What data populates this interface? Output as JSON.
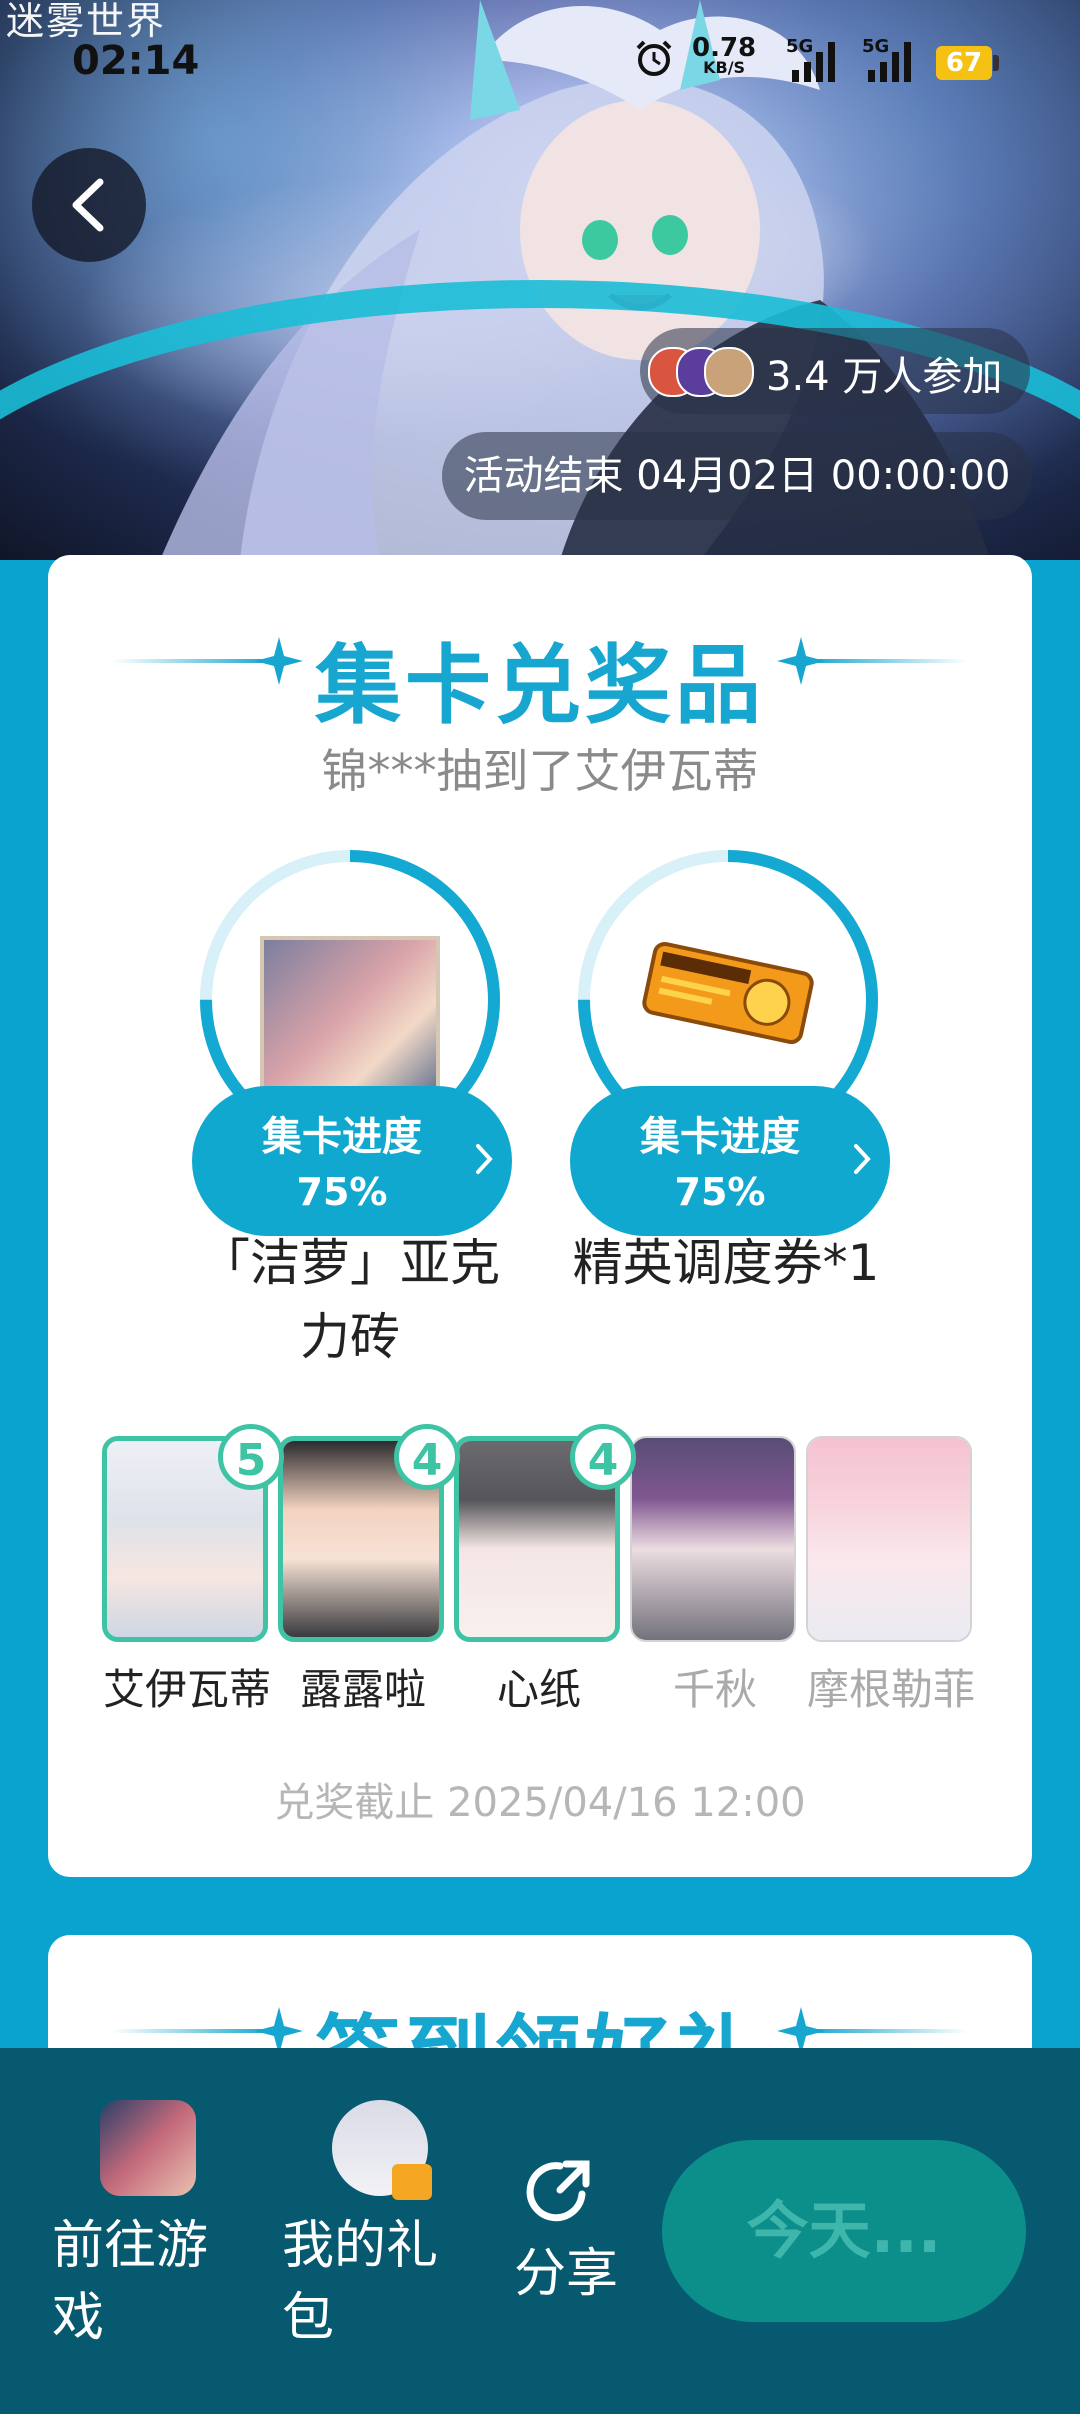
{
  "status_bar": {
    "logo_text": "迷雾世界",
    "time": "02:14",
    "net_speed": "0.78",
    "net_unit": "KB/S",
    "sim1": "5G",
    "sim2": "5G",
    "battery": "67"
  },
  "hero": {
    "participants": "3.4 万人参加",
    "end_time": "活动结束 04月02日 00:00:00"
  },
  "collect_card": {
    "title": "集卡兑奖品",
    "subtitle": "锦***抽到了艾伊瓦蒂",
    "prizes": [
      {
        "progress_label": "集卡进度",
        "progress": "75%",
        "progress_value": 0.75,
        "name_line1": "「洁萝」亚克",
        "name_line2": "力砖"
      },
      {
        "progress_label": "集卡进度",
        "progress": "75%",
        "progress_value": 0.75,
        "name_line1": "精英调度券*1",
        "name_line2": ""
      }
    ],
    "cards": [
      {
        "name": "艾伊瓦蒂",
        "count": "5"
      },
      {
        "name": "露露啦",
        "count": "4"
      },
      {
        "name": "心纸",
        "count": "4"
      },
      {
        "name": "千秋",
        "count": ""
      },
      {
        "name": "摩根勒菲",
        "count": ""
      }
    ],
    "deadline": "兑奖截止 2025/04/16 12:00"
  },
  "signin_card": {
    "title": "签到领好礼"
  },
  "bottom_bar": {
    "goto_game": "前往游戏",
    "my_gifts": "我的礼包",
    "share": "分享",
    "today": "今天..."
  },
  "colors": {
    "accent": "#17a6cf",
    "card_border": "#3ec3a4",
    "bottom_bar": "#07596f"
  }
}
